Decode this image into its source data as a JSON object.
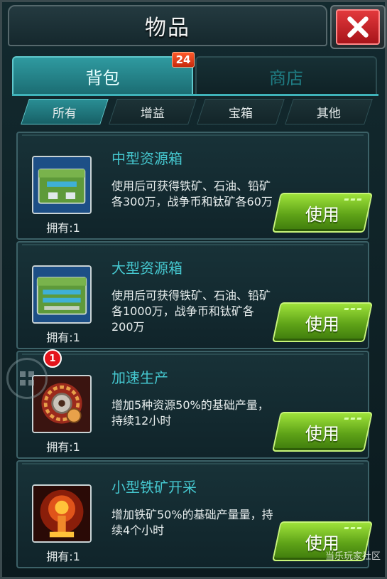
{
  "window": {
    "title": "物品"
  },
  "tabs": [
    {
      "label": "背包",
      "badge": "24"
    },
    {
      "label": "商店"
    }
  ],
  "filters": [
    "所有",
    "增益",
    "宝箱",
    "其他"
  ],
  "items": [
    {
      "name": "中型资源箱",
      "description": "使用后可获得铁矿、石油、铅矿各300万，战争币和钛矿各60万",
      "owned": "拥有:1",
      "button": "使用",
      "icon": "medium-resource-crate-icon"
    },
    {
      "name": "大型资源箱",
      "description": "使用后可获得铁矿、石油、铅矿各1000万，战争币和钛矿各200万",
      "owned": "拥有:1",
      "button": "使用",
      "icon": "large-resource-crate-icon"
    },
    {
      "name": "加速生产",
      "description": "增加5种资源50%的基础产量，持续12小时",
      "owned": "拥有:1",
      "button": "使用",
      "icon": "production-gear-icon"
    },
    {
      "name": "小型铁矿开采",
      "description": "增加铁矿50%的基础产量量，持续4个小时",
      "owned": "拥有:1",
      "button": "使用",
      "icon": "iron-mining-blast-icon"
    }
  ],
  "notification": {
    "count": "1"
  },
  "watermark": "当乐玩家社区",
  "colors": {
    "accent": "#45c7cf",
    "use_button": "#6fb81f",
    "close_button": "#d0282d"
  }
}
